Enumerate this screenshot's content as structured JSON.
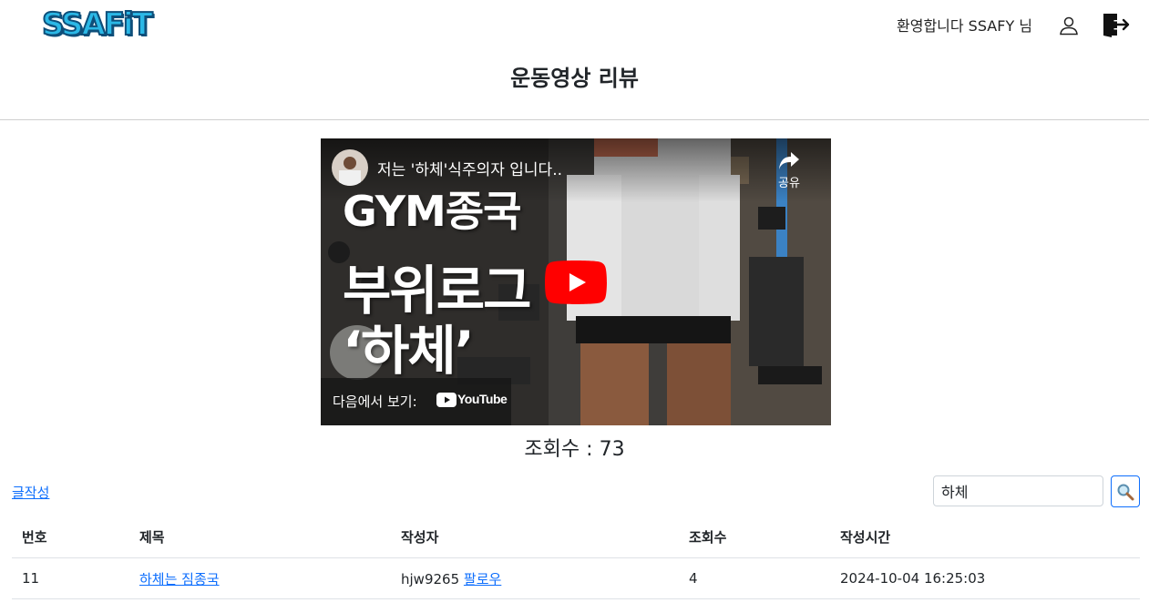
{
  "header": {
    "logo_text": "SSAFiT",
    "welcome_text": "환영합니다 SSAFY 님",
    "user_icon": "user-icon",
    "logout_icon": "logout-icon",
    "page_title": "운동영상 리뷰"
  },
  "video": {
    "title": "저는 '하체'식주의자 입니다..",
    "share_label": "공유",
    "thumbnail_text_1": "GYM종국",
    "thumbnail_text_2": "부위로그",
    "thumbnail_text_3": "‘하체’",
    "watch_on_label": "다음에서 보기:",
    "youtube_label": "YouTube"
  },
  "views": {
    "label": "조회수",
    "separator": ":",
    "value": "73"
  },
  "toolbar": {
    "write_label": "글작성",
    "search_value": "하체",
    "search_icon": "magnifier-icon"
  },
  "board": {
    "columns": [
      "번호",
      "제목",
      "작성자",
      "조회수",
      "작성시간"
    ],
    "rows": [
      {
        "no": "11",
        "title": "하체는 짐종국",
        "writer": "hjw9265",
        "follow_label": "팔로우",
        "views": "4",
        "created": "2024-10-04 16:25:03"
      }
    ]
  },
  "colors": {
    "link": "#0d6efd",
    "youtube_red": "#ff0000",
    "logo_blue": "#2bb8e6"
  }
}
